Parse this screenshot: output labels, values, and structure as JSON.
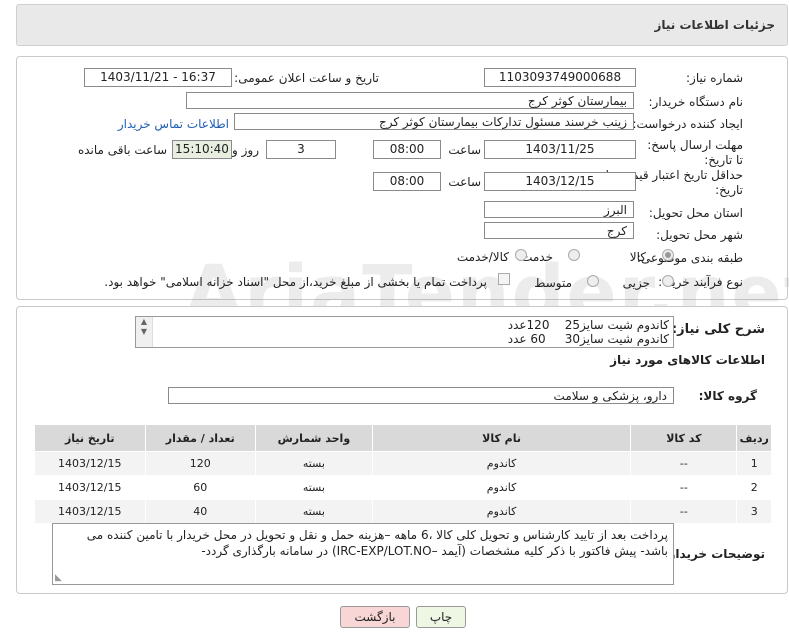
{
  "page": {
    "title": "جزئیات اطلاعات نیاز",
    "watermark": "AriaTender.net"
  },
  "form": {
    "need_number": {
      "label": "شماره نیاز:",
      "value": "1103093749000688"
    },
    "announce": {
      "label": "تاریخ و ساعت اعلان عمومی:",
      "value": "1403/11/21 - 16:37"
    },
    "buyer": {
      "label": "نام دستگاه خریدار:",
      "value": "بیمارستان کوثر کرج"
    },
    "requester": {
      "label": "ایجاد کننده درخواست:",
      "value": "زینب خرسند مسئول تدارکات بیمارستان کوثر کرج",
      "contact_link": "اطلاعات تماس خریدار"
    },
    "deadline": {
      "label": "مهلت ارسال پاسخ: تا تاریخ:",
      "date": "1403/11/25",
      "time_label": "ساعت",
      "time": "08:00",
      "days": "3",
      "days_label": "روز و",
      "remaining": "15:10:40",
      "remaining_label": "ساعت باقی مانده"
    },
    "validity": {
      "label": "حداقل تاریخ اعتبار قیمت: تا تاریخ:",
      "date": "1403/12/15",
      "time_label": "ساعت",
      "time": "08:00"
    },
    "province": {
      "label": "استان محل تحویل:",
      "value": "البرز"
    },
    "city": {
      "label": "شهر محل تحویل:",
      "value": "کرج"
    },
    "category": {
      "label": "طبقه بندی موضوعی:",
      "options": [
        "کالا",
        "خدمت",
        "کالا/خدمت"
      ],
      "selected": "کالا"
    },
    "purchase": {
      "label": "نوع فرآیند خرید :",
      "options": [
        "جزیی",
        "متوسط"
      ],
      "note": "پرداخت تمام یا بخشی از مبلغ خرید،از محل \"اسناد خزانه اسلامی\" خواهد بود."
    }
  },
  "summary": {
    "label": "شرح کلی نیاز:",
    "lines": [
      "کاندوم شیت سایز25    120عدد",
      "کاندوم شیت سایز30     60 عدد"
    ]
  },
  "goods": {
    "section_title": "اطلاعات کالاهای مورد نیاز",
    "group_label": "گروه کالا:",
    "group_value": "دارو، پزشکی و سلامت",
    "columns": [
      "ردیف",
      "کد کالا",
      "نام کالا",
      "واحد شمارش",
      "تعداد / مقدار",
      "تاریخ نیاز"
    ],
    "rows": [
      [
        "1",
        "--",
        "کاندوم",
        "بسته",
        "120",
        "1403/12/15"
      ],
      [
        "2",
        "--",
        "کاندوم",
        "بسته",
        "60",
        "1403/12/15"
      ],
      [
        "3",
        "--",
        "کاندوم",
        "بسته",
        "40",
        "1403/12/15"
      ]
    ]
  },
  "notes": {
    "label": "توضیحات خریدار:",
    "text": "پرداخت بعد از تایید کارشناس و تحویل کلی کالا ،6 ماهه –هزینه حمل و نقل و تحویل در محل خریدار با تامین کننده می باشد- پیش فاکتور با ذکر کلیه مشخصات (آیمد –IRC-EXP/LOT.NO) در سامانه بارگذاری گردد-"
  },
  "buttons": {
    "print": "چاپ",
    "back": "بازگشت"
  },
  "colors": {
    "back_button": "#f9d6d6",
    "print_button": "#eef6e4",
    "link": "#1f5fb0"
  }
}
